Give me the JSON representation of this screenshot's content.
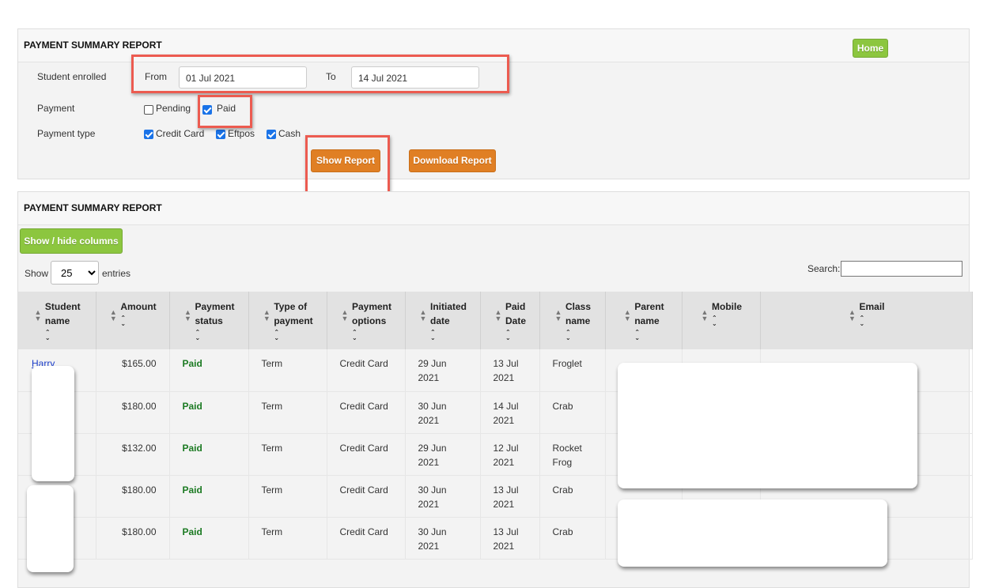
{
  "filter_panel": {
    "title": "PAYMENT SUMMARY REPORT",
    "home_label": "Home",
    "student_enrolled_label": "Student enrolled",
    "from_label": "From",
    "from_value": "01 Jul 2021",
    "to_label": "To",
    "to_value": "14 Jul 2021",
    "payment_label": "Payment",
    "payment_options": [
      {
        "label": "Pending",
        "checked": false
      },
      {
        "label": "Paid",
        "checked": true
      }
    ],
    "payment_type_label": "Payment type",
    "payment_types": [
      {
        "label": "Credit Card",
        "checked": true
      },
      {
        "label": "Eftpos",
        "checked": true
      },
      {
        "label": "Cash",
        "checked": true
      }
    ],
    "show_report_label": "Show Report",
    "download_report_label": "Download Report"
  },
  "report_panel": {
    "title": "PAYMENT SUMMARY REPORT",
    "show_hide_columns_label": "Show / hide columns",
    "show_label": "Show",
    "entries_value": "25",
    "entries_label": "entries",
    "search_label": "Search:"
  },
  "table": {
    "columns": [
      [
        "Student",
        "name"
      ],
      [
        "Amount"
      ],
      [
        "Payment",
        "status"
      ],
      [
        "Type of",
        "payment"
      ],
      [
        "Payment",
        "options"
      ],
      [
        "Initiated",
        "date"
      ],
      [
        "Paid",
        "Date"
      ],
      [
        "Class",
        "name"
      ],
      [
        "Parent",
        "name"
      ],
      [
        "Mobile"
      ],
      [
        "Email"
      ]
    ],
    "rows": [
      {
        "student": "Harry",
        "amount": "$165.00",
        "status": "Paid",
        "type": "Term",
        "option": "Credit Card",
        "initiated": [
          "29 Jun",
          "2021"
        ],
        "paid": [
          "13 Jul",
          "2021"
        ],
        "class": [
          "Froglet"
        ]
      },
      {
        "student": "",
        "amount": "$180.00",
        "status": "Paid",
        "type": "Term",
        "option": "Credit Card",
        "initiated": [
          "30 Jun",
          "2021"
        ],
        "paid": [
          "14 Jul",
          "2021"
        ],
        "class": [
          "Crab"
        ]
      },
      {
        "student": "",
        "amount": "$132.00",
        "status": "Paid",
        "type": "Term",
        "option": "Credit Card",
        "initiated": [
          "29 Jun",
          "2021"
        ],
        "paid": [
          "12 Jul",
          "2021"
        ],
        "class": [
          "Rocket",
          "Frog"
        ]
      },
      {
        "student": "",
        "amount": "$180.00",
        "status": "Paid",
        "type": "Term",
        "option": "Credit Card",
        "initiated": [
          "30 Jun",
          "2021"
        ],
        "paid": [
          "13 Jul",
          "2021"
        ],
        "class": [
          "Crab"
        ]
      },
      {
        "student": "",
        "amount": "$180.00",
        "status": "Paid",
        "type": "Term",
        "option": "Credit Card",
        "initiated": [
          "30 Jun",
          "2021"
        ],
        "paid": [
          "13 Jul",
          "2021"
        ],
        "class": [
          "Crab"
        ]
      }
    ]
  }
}
